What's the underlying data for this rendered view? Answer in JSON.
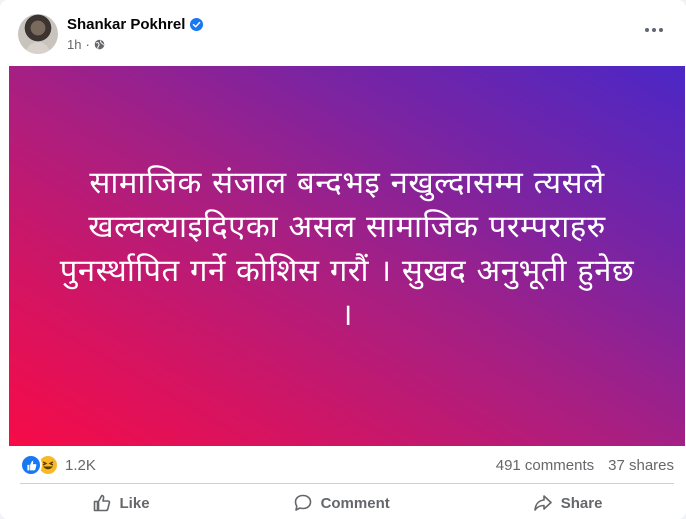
{
  "post": {
    "author": "Shankar Pokhrel",
    "time": "1h",
    "meta_separator": "·",
    "body": "सामाजिक संजाल बन्दभइ नखुल्दासम्म त्यसले खल्वल्याइदिएका असल सामाजिक परम्पराहरु पुनर्स्थापित गर्ने कोशिस गरौं । सुखद अनुभूती हुनेछ ।",
    "gradient_colors": [
      "#f70b47",
      "#a81f82",
      "#4b27c6"
    ]
  },
  "stats": {
    "reaction_count": "1.2K",
    "comments": "491 comments",
    "shares": "37 shares"
  },
  "actions": {
    "like": "Like",
    "comment": "Comment",
    "share": "Share"
  },
  "icons": {
    "verified": "verified-badge-icon",
    "privacy": "globe-icon",
    "more": "more-options-icon",
    "like_reaction": "like-reaction-icon",
    "haha_reaction": "haha-reaction-icon",
    "like_action": "thumbs-up-icon",
    "comment_action": "speech-bubble-icon",
    "share_action": "share-arrow-icon"
  },
  "colors": {
    "brand_blue": "#1877f2",
    "secondary_text": "#65676b"
  }
}
